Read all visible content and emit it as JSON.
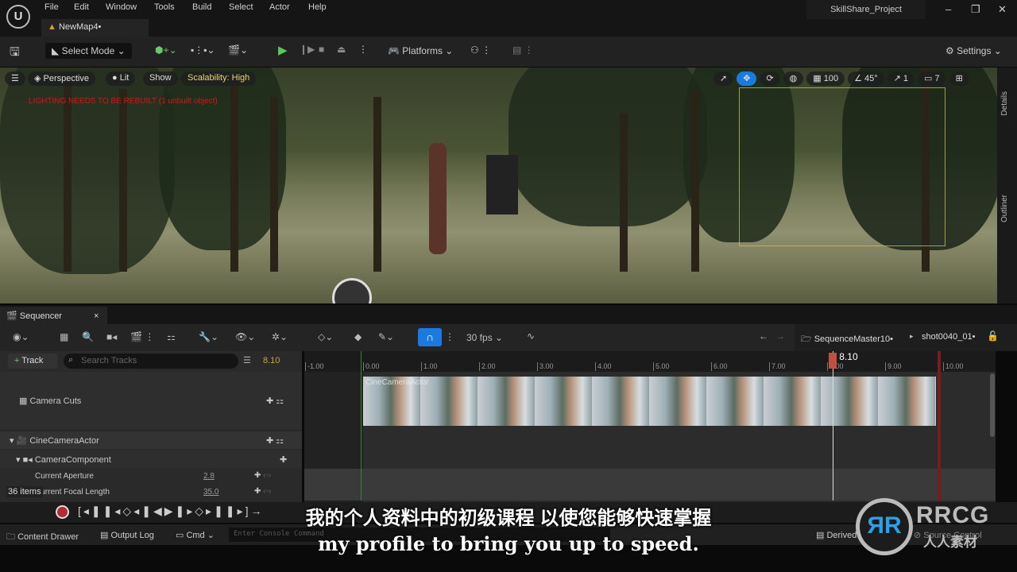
{
  "menu": {
    "logo": "U",
    "items": [
      "File",
      "Edit",
      "Window",
      "Tools",
      "Build",
      "Select",
      "Actor",
      "Help"
    ]
  },
  "level_tab": "NewMap4•",
  "project_title": "SkillShare_Project",
  "toolbar": {
    "select_mode": "Select Mode",
    "platforms": "Platforms",
    "settings": "Settings"
  },
  "viewport": {
    "perspective": "Perspective",
    "lit": "Lit",
    "show": "Show",
    "scalability": "Scalability: High",
    "warning": "LIGHTING NEEDS TO BE REBUILT (1 unbuilt object)",
    "grid_snap": "100",
    "rot_snap": "45°",
    "scale_snap": "1",
    "camera_speed": "7"
  },
  "side_tabs": [
    "Details",
    "Outliner"
  ],
  "sequencer": {
    "tab": "Sequencer",
    "fps": "30 fps",
    "breadcrumb": [
      "SequenceMaster10•",
      "shot0040_01•"
    ],
    "track_button": "Track",
    "search_placeholder": "Search Tracks",
    "current_time": "8.10",
    "ruler_ticks": [
      "-1.00",
      "0.00",
      "1.00",
      "2.00",
      "3.00",
      "4.00",
      "5.00",
      "6.00",
      "7.00",
      "8.00",
      "9.00",
      "10.00"
    ],
    "clip_label": "CineCameraActor",
    "tracks": [
      {
        "label": "Camera Cuts"
      },
      {
        "label": "CineCameraActor"
      },
      {
        "label": "CameraComponent"
      },
      {
        "label": "Current Aperture",
        "value": "2.8"
      },
      {
        "label": "Current Focal Length",
        "value": "35.0"
      }
    ],
    "items_count": "36 items"
  },
  "statusbar": {
    "content_drawer": "Content Drawer",
    "output_log": "Output Log",
    "cmd": "Cmd",
    "console_placeholder": "Enter Console Command",
    "derived_data": "Derived Data",
    "source_control": "Source Control"
  },
  "subtitles": {
    "chinese": "我的个人资料中的初级课程 以使您能够快速掌握",
    "english": "my profile to bring you up to speed."
  },
  "watermark": {
    "brand": "RRCG",
    "sub": "人人素材"
  },
  "colors": {
    "accent": "#1a7ae0",
    "playhead": "#c25040",
    "record": "#b02a3a",
    "scalability": "#e8d66a"
  }
}
